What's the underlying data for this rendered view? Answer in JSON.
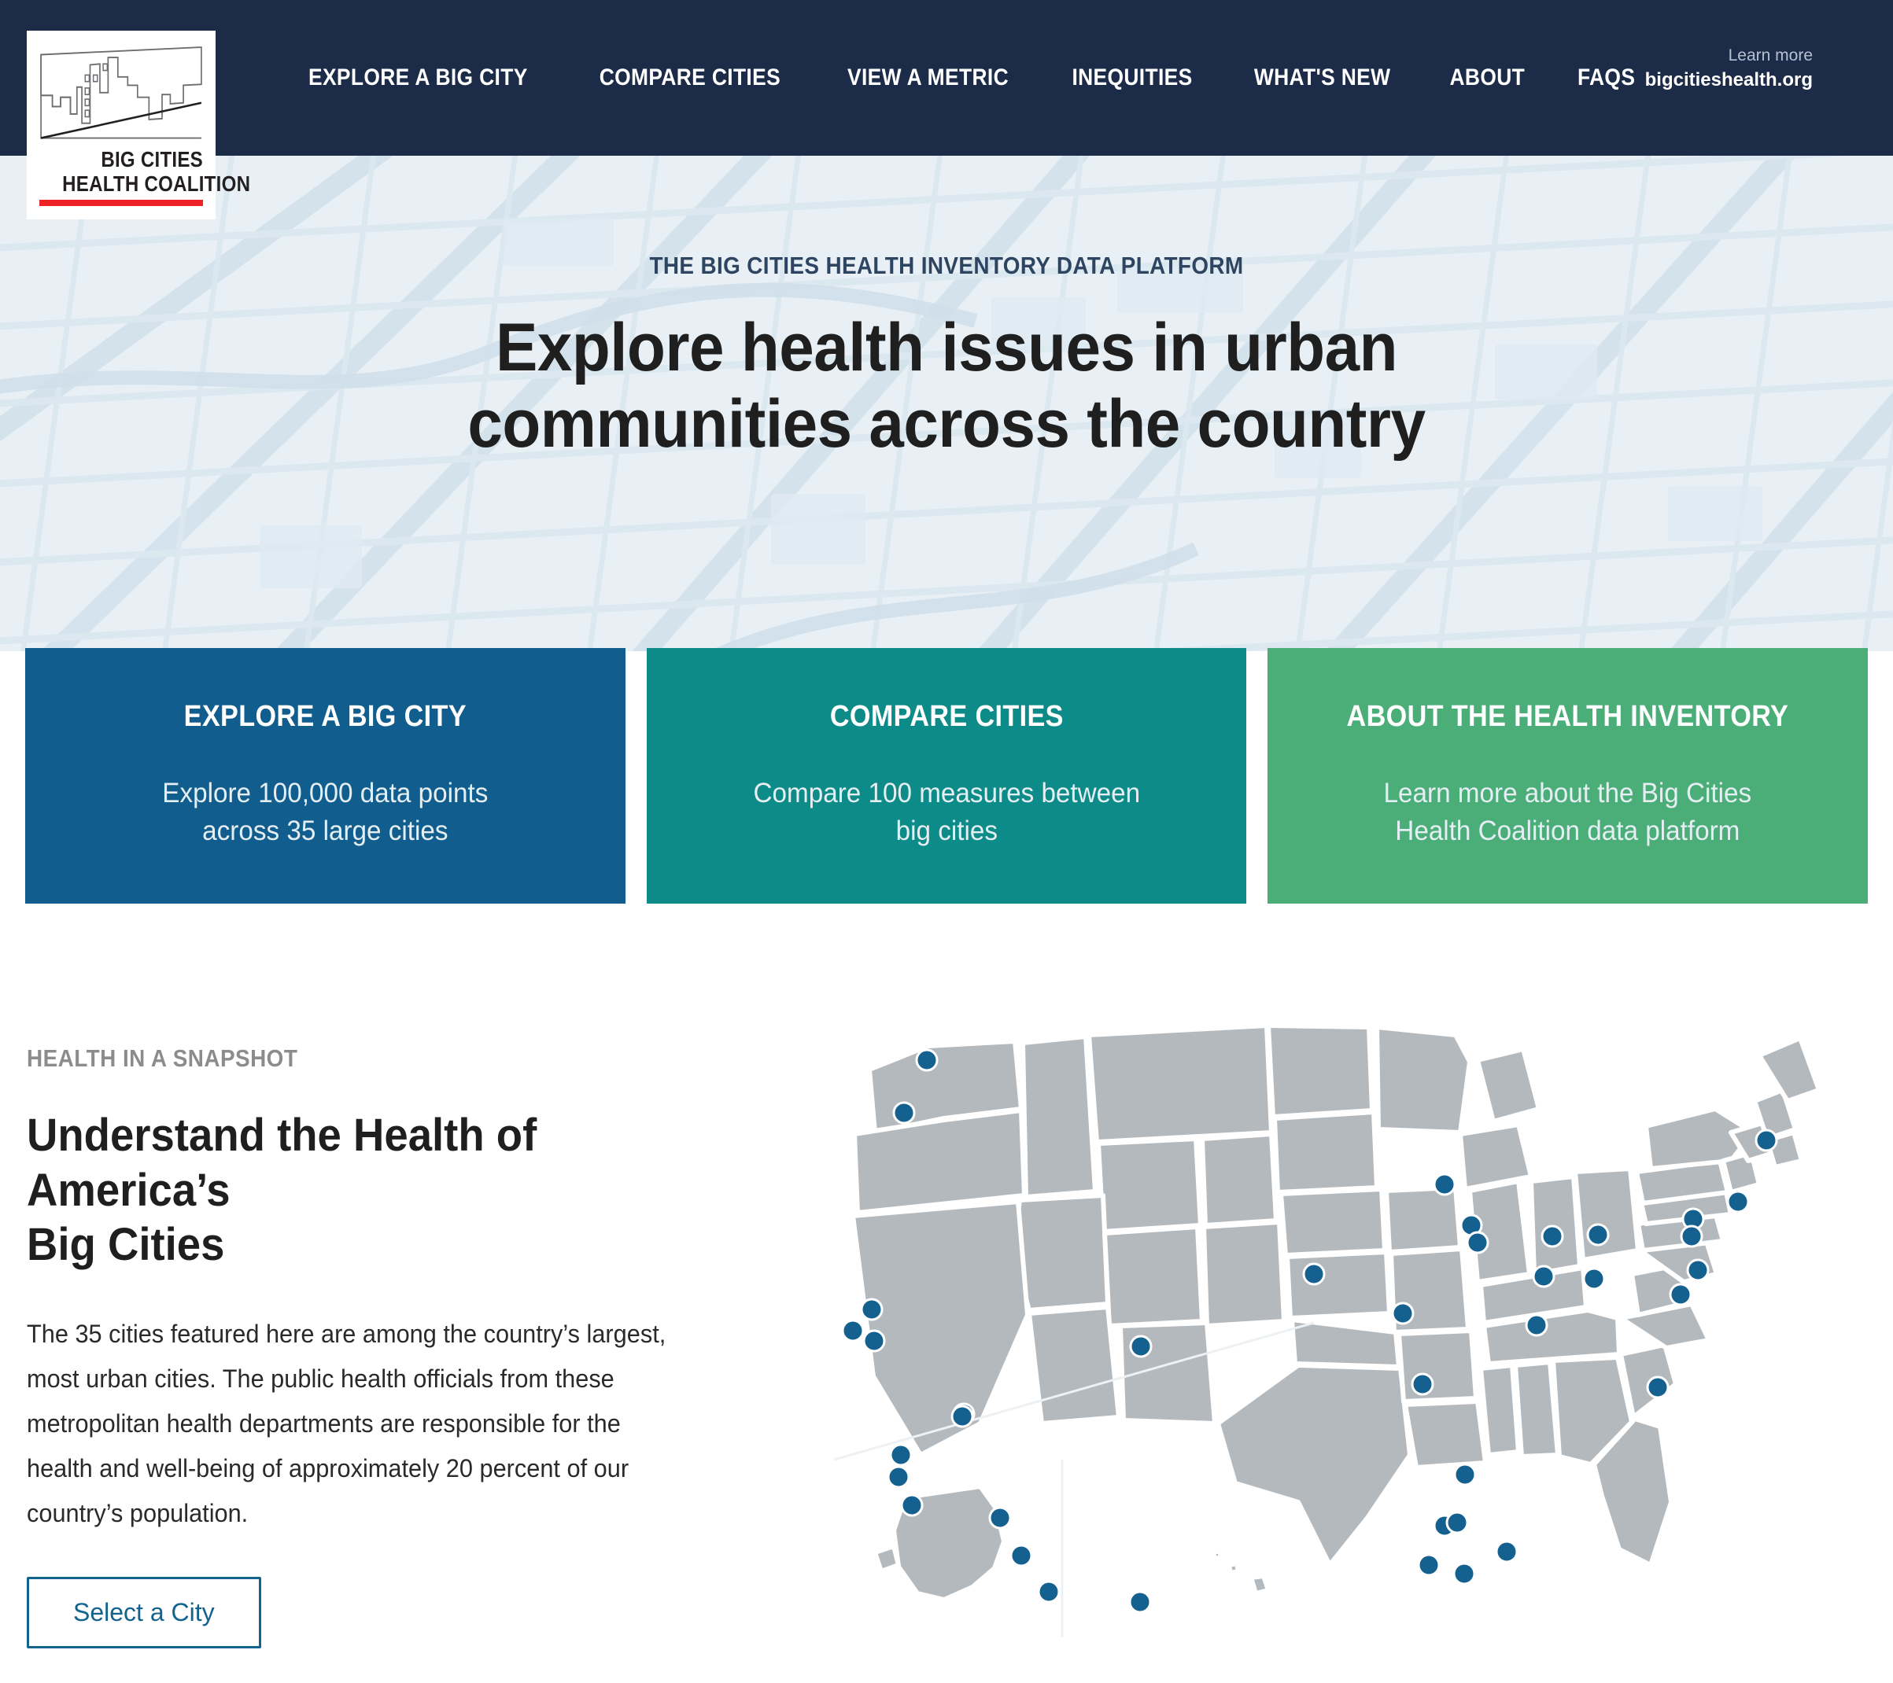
{
  "brand": {
    "logo_line1": "BIG CITIES",
    "logo_line2": "HEALTH COALITION",
    "logo_icon": "city-skyline-chart-icon"
  },
  "nav": {
    "items": [
      {
        "label": "EXPLORE A BIG CITY"
      },
      {
        "label": "COMPARE CITIES"
      },
      {
        "label": "VIEW A METRIC"
      },
      {
        "label": "INEQUITIES"
      },
      {
        "label": "WHAT'S NEW"
      },
      {
        "label": "ABOUT"
      },
      {
        "label": "FAQS"
      }
    ],
    "learn_more_label": "Learn more",
    "site_url": "bigcitieshealth.org",
    "background_color": "#1b2b48"
  },
  "hero": {
    "kicker": "THE BIG CITIES HEALTH INVENTORY DATA PLATFORM",
    "title_line1": "Explore health issues in urban",
    "title_line2": "communities across the country",
    "background_color": "#e9f0f5",
    "background_icon": "street-map-background"
  },
  "cards": [
    {
      "title": "EXPLORE A BIG CITY",
      "desc_line1": "Explore 100,000 data points",
      "desc_line2": "across 35 large cities",
      "color": "#115e8e"
    },
    {
      "title": "COMPARE CITIES",
      "desc_line1": "Compare 100 measures between",
      "desc_line2": "big cities",
      "color": "#0d8b88"
    },
    {
      "title": "ABOUT THE HEALTH INVENTORY",
      "desc_line1": "Learn more about the Big Cities",
      "desc_line2": "Health Coalition data platform",
      "color": "#4bae79"
    }
  ],
  "snapshot": {
    "kicker": "HEALTH IN A SNAPSHOT",
    "title_line1": "Understand the Health of America’s",
    "title_line2": "Big Cities",
    "body": "The 35 cities featured here are among the country’s largest, most urban cities. The public health officials from these metropolitan health departments are responsible for the health and well-being of approximately 20 percent of our country’s population.",
    "button_label": "Select a City",
    "button_color": "#13638f",
    "map": {
      "icon": "us-map-with-city-markers",
      "land_color": "#b4b9be",
      "marker_color": "#14608f",
      "marker_count": 35
    }
  }
}
